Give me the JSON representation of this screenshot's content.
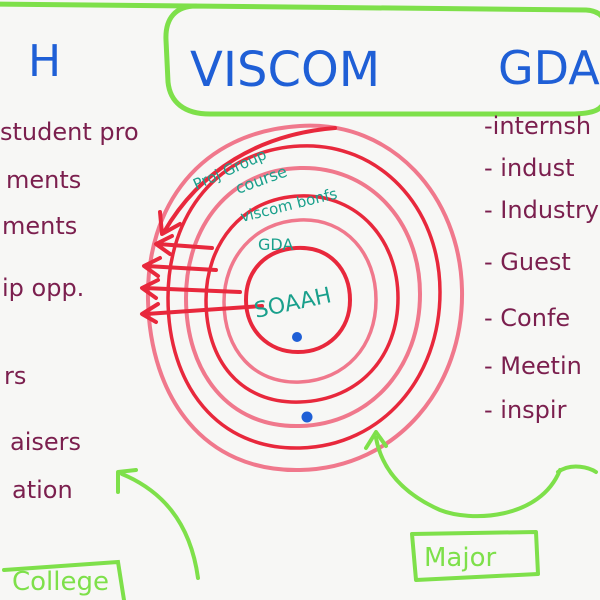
{
  "colors": {
    "board": "#f7f7f5",
    "blue": "#1f5fd6",
    "green": "#7ee04a",
    "maroon": "#7b1f4e",
    "red": "#e8283c",
    "pink": "#f0788c",
    "teal": "#1aa08c"
  },
  "header": {
    "left_fragment": "H",
    "viscom": "VISCOM",
    "gda_fragment": "GDA"
  },
  "left_list": [
    "student pro",
    "ments",
    "ments",
    "ip opp.",
    "rs",
    "aisers",
    "ation"
  ],
  "right_list": [
    "-internsh",
    "- indust",
    "- Industry",
    "- Guest",
    "- Confe",
    "- Meetin",
    "- inspir"
  ],
  "rings": {
    "labels": [
      "Proj Group",
      "course",
      "viscom bonfs",
      "GDA",
      "SOAAH"
    ]
  },
  "boxes": {
    "college": "College",
    "major": "Major"
  }
}
